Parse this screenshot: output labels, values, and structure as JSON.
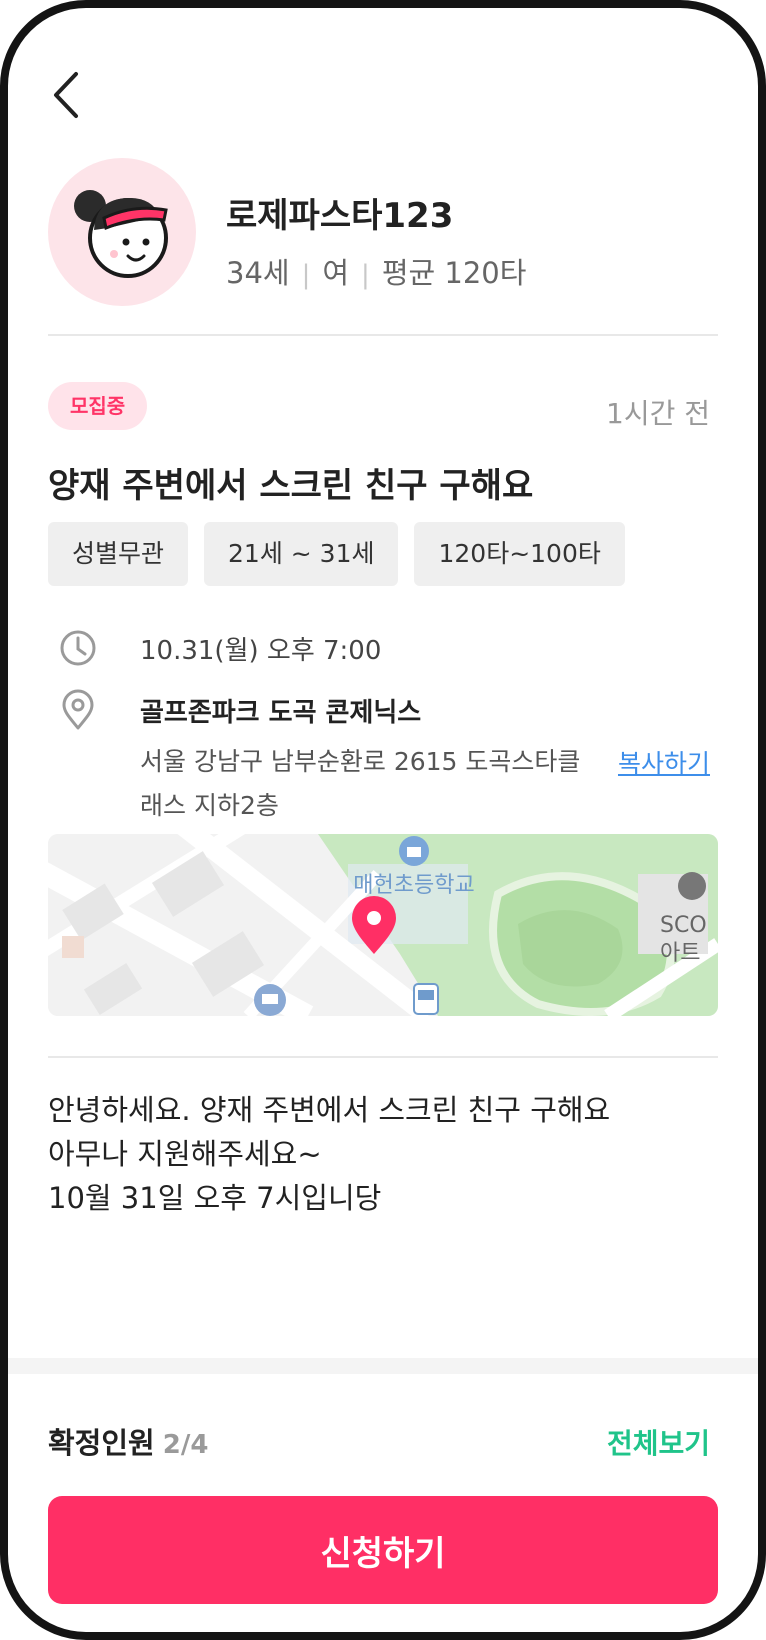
{
  "profile": {
    "nickname": "로제파스타123",
    "age": "34세",
    "gender": "여",
    "average": "평균 120타"
  },
  "post": {
    "status_badge": "모집중",
    "time_ago": "1시간 전",
    "title": "양재 주변에서 스크린 친구 구해요",
    "chips": [
      "성별무관",
      "21세 ~ 31세",
      "120타~100타"
    ],
    "datetime": "10.31(월)  오후 7:00",
    "place_name": "골프존파크 도곡 콘제닉스",
    "address": "서울 강남구 남부순환로 2615 도곡스타클래스 지하2층",
    "copy_label": "복사하기",
    "body_lines": [
      "안녕하세요. 양재 주변에서 스크린 친구 구해요",
      "아무나 지원해주세요~",
      "10월 31일 오후 7시입니당"
    ]
  },
  "map": {
    "school_label": "매헌초등학교",
    "poi_label_1": "SCO",
    "poi_label_2": "아트"
  },
  "footer": {
    "confirmed_label": "확정인원",
    "confirmed_count": "2/4",
    "view_all_label": "전체보기",
    "apply_label": "신청하기"
  },
  "colors": {
    "accent": "#ff2f65",
    "badge_bg": "#ffe3ea",
    "link": "#3d8eea",
    "green": "#20c48a",
    "chip_bg": "#efefef"
  }
}
